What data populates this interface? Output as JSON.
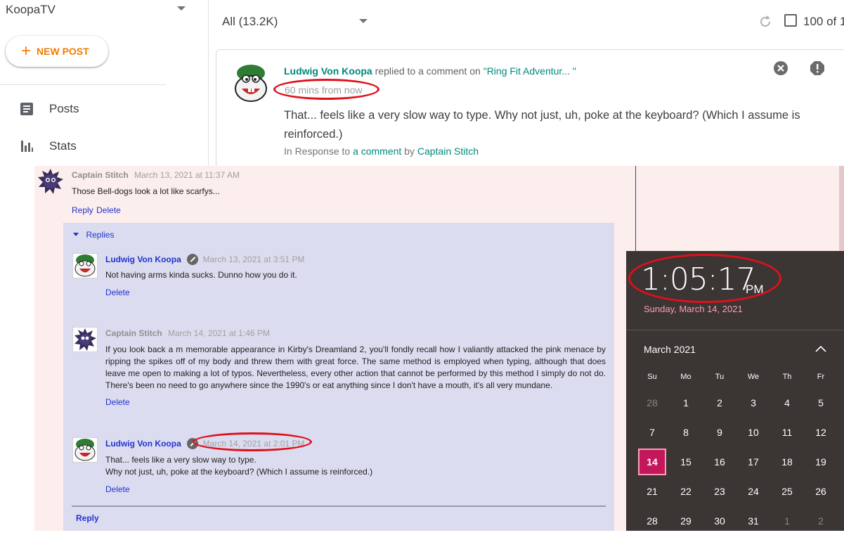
{
  "sidebar": {
    "blog_title": "KoopaTV",
    "new_post": "NEW POST",
    "nav": [
      {
        "label": "Posts",
        "icon": "posts-icon"
      },
      {
        "label": "Stats",
        "icon": "stats-icon"
      }
    ]
  },
  "header": {
    "filter": "All (13.2K)",
    "page_count": "100 of 1"
  },
  "card": {
    "author": "Ludwig Von Koopa",
    "action": "replied to a comment on",
    "post_title": "\"Ring Fit Adventur... \"",
    "time": "60 mins from now",
    "body": "That... feels like a very slow way to type. Why not just, uh, poke at the keyboard? (Which I assume is reinforced.)",
    "response_prefix": "In Response to",
    "response_link": "a comment",
    "response_by": "by",
    "response_author": "Captain Stitch"
  },
  "thread": {
    "parent": {
      "author": "Captain Stitch",
      "date": "March 13, 2021 at 11:37 AM",
      "text": "Those Bell-dogs look a lot like scarfys...",
      "reply": "Reply",
      "delete": "Delete"
    },
    "replies_label": "Replies",
    "replies": [
      {
        "author": "Ludwig Von Koopa",
        "date": "March 13, 2021 at 3:51 PM",
        "text": "Not having arms kinda sucks. Dunno how you do it.",
        "delete": "Delete"
      },
      {
        "author": "Captain Stitch",
        "date": "March 14, 2021 at 1:46 PM",
        "text": "If you look back a m memorable appearance in Kirby's Dreamland 2, you'll fondly recall how I valiantly attacked the pink menace by ripping the spikes off of my body and threw them with great force. The same method is employed when typing, although that does leave me open to making a lot of typos. Nevertheless, every other action that cannot be performed by this method I simply do not do. There's been no need to go anywhere since the 1990's or eat anything since I don't have a mouth, it's all very mundane.",
        "delete": "Delete"
      },
      {
        "author": "Ludwig Von Koopa",
        "date": "March 14, 2021 at 2:01 PM",
        "text_line1": "That... feels like a very slow way to type.",
        "text_line2": "Why not just, uh, poke at the keyboard? (Which I assume is reinforced.)",
        "delete": "Delete"
      }
    ],
    "reply_bottom": "Reply"
  },
  "calendar": {
    "time": "1:05:17",
    "ampm": "PM",
    "date": "Sunday, March 14, 2021",
    "month": "March 2021",
    "weekdays": [
      "Su",
      "Mo",
      "Tu",
      "We",
      "Th",
      "Fr"
    ],
    "weeks": [
      [
        "28",
        "1",
        "2",
        "3",
        "4",
        "5"
      ],
      [
        "7",
        "8",
        "9",
        "10",
        "11",
        "12"
      ],
      [
        "14",
        "15",
        "16",
        "17",
        "18",
        "19"
      ],
      [
        "21",
        "22",
        "23",
        "24",
        "25",
        "26"
      ],
      [
        "28",
        "29",
        "30",
        "31",
        "1",
        "2"
      ]
    ],
    "today": "14",
    "colors": {
      "accent": "#c2185b",
      "background": "#3b3534"
    }
  },
  "annotation_color": "#e0101a"
}
